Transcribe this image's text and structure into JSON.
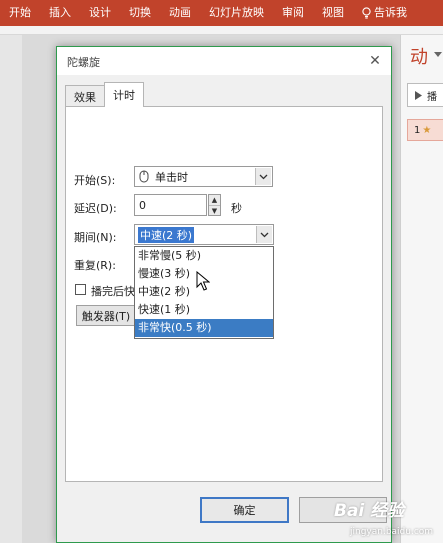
{
  "ribbon": {
    "tabs": [
      "开始",
      "插入",
      "设计",
      "切换",
      "动画",
      "幻灯片放映",
      "审阅",
      "视图"
    ],
    "tell_me": "告诉我"
  },
  "animation_pane": {
    "title": "动",
    "play_label": "播",
    "item_number": "1",
    "item_star": "★"
  },
  "dialog": {
    "title": "陀螺旋",
    "close": "✕",
    "tabs": [
      {
        "label": "效果",
        "active": false
      },
      {
        "label": "计时",
        "active": true
      }
    ],
    "start": {
      "label": "开始(S):",
      "value": "单击时"
    },
    "delay": {
      "label": "延迟(D):",
      "value": "0",
      "unit": "秒"
    },
    "duration": {
      "label": "期间(N):",
      "value": "中速(2 秒)",
      "options": [
        "非常慢(5 秒)",
        "慢速(3 秒)",
        "中速(2 秒)",
        "快速(1 秒)",
        "非常快(0.5 秒)"
      ],
      "highlighted_index": 4
    },
    "repeat": {
      "label": "重复(R):"
    },
    "rewind": {
      "label": "播完后快退",
      "checked": false
    },
    "trigger_button": "触发器(T)",
    "ok_button": "确定"
  },
  "watermark": {
    "brand": "Bai 经验",
    "site": "jingyan.baidu.com"
  }
}
